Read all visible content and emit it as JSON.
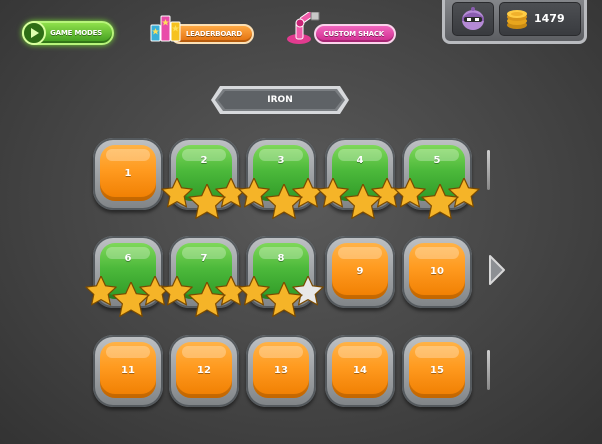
{
  "top_bar": {
    "game_modes": "GAME MODES",
    "leaderboard": "LEADERBOARD",
    "custom_shack": "CUSTOM SHACK"
  },
  "hud": {
    "coins": "1479",
    "avatar_icon": "ninja-avatar-icon",
    "coin_icon": "coin-stack-icon"
  },
  "world": {
    "name": "IRON"
  },
  "levels": [
    {
      "number": "1",
      "state": "unlocked",
      "stars": 0
    },
    {
      "number": "2",
      "state": "completed",
      "stars": 3
    },
    {
      "number": "3",
      "state": "completed",
      "stars": 3
    },
    {
      "number": "4",
      "state": "completed",
      "stars": 3
    },
    {
      "number": "5",
      "state": "completed",
      "stars": 3
    },
    {
      "number": "6",
      "state": "completed",
      "stars": 3
    },
    {
      "number": "7",
      "state": "completed",
      "stars": 3
    },
    {
      "number": "8",
      "state": "completed",
      "stars": 2
    },
    {
      "number": "9",
      "state": "unlocked",
      "stars": 0
    },
    {
      "number": "10",
      "state": "unlocked",
      "stars": 0
    },
    {
      "number": "11",
      "state": "unlocked",
      "stars": 0
    },
    {
      "number": "12",
      "state": "unlocked",
      "stars": 0
    },
    {
      "number": "13",
      "state": "unlocked",
      "stars": 0
    },
    {
      "number": "14",
      "state": "unlocked",
      "stars": 0
    },
    {
      "number": "15",
      "state": "unlocked",
      "stars": 0
    }
  ],
  "colors": {
    "orange": "#ff9a1f",
    "green": "#4cb93b",
    "star_gold": "#f5b428",
    "star_empty": "#e8e8e8"
  }
}
